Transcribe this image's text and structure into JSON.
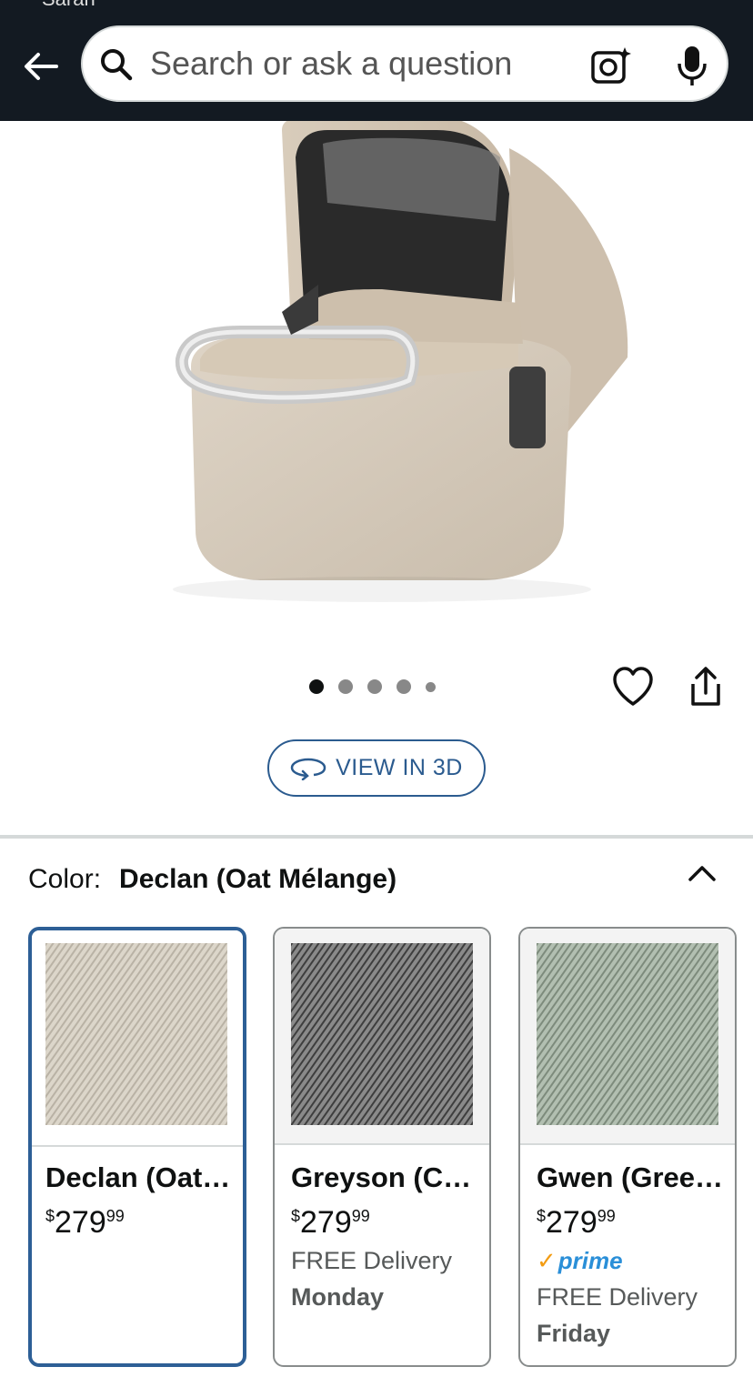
{
  "status_bar": {
    "fragment": "Sarah"
  },
  "header": {
    "search_placeholder": "Search or ask a question"
  },
  "product": {
    "image_alt": "UPPAbaby bassinet in Declan (Oat Mélange)",
    "carousel": {
      "count": 5,
      "active": 0
    },
    "view_3d_label": "VIEW IN 3D"
  },
  "variation": {
    "label": "Color:",
    "selected_value": "Declan (Oat Mélange)",
    "options": [
      {
        "name": "Declan (Oat Mélange)",
        "price_dollars": "279",
        "price_cents": "99",
        "currency": "$",
        "prime": "",
        "delivery": "",
        "delivery_day": "",
        "swatch_color": "#d9d3c7"
      },
      {
        "name": "Greyson (Charcoal Mélange)",
        "price_dollars": "279",
        "price_cents": "99",
        "currency": "$",
        "prime": "",
        "delivery": "FREE Delivery",
        "delivery_day": "Monday",
        "swatch_color": "#6e6e6e"
      },
      {
        "name": "Gwen (Green Mélange)",
        "price_dollars": "279",
        "price_cents": "99",
        "currency": "$",
        "prime": "prime",
        "delivery": "FREE Delivery",
        "delivery_day": "Friday",
        "swatch_color": "#9fad9e"
      }
    ]
  },
  "colors": {
    "accent": "#2d5f96",
    "header_bg": "#131a22",
    "prime_blue": "#2a8fd8"
  }
}
